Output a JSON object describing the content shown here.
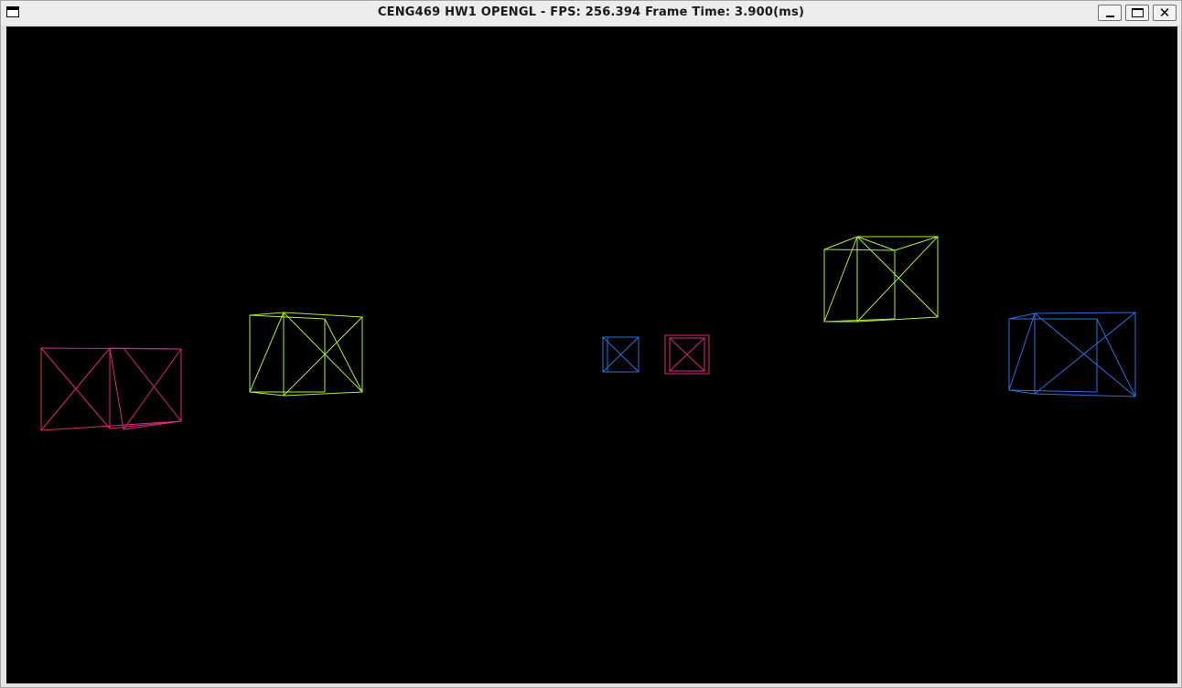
{
  "window": {
    "title": "CENG469 HW1 OPENGL - FPS: 256.394 Frame Time: 3.900(ms)",
    "buttons": {
      "minimize_icon": "minimize-icon",
      "maximize_icon": "maximize-icon",
      "close_icon": "close-icon",
      "close_glyph": "✕"
    }
  },
  "scene": {
    "background": "#000000",
    "colors": {
      "pink": "#e0267a",
      "green": "#a8f03c",
      "blue": "#2f6fe0"
    },
    "objects": [
      {
        "name": "pink-cube-left",
        "color": "pink"
      },
      {
        "name": "green-cube-left",
        "color": "green"
      },
      {
        "name": "blue-cube-center",
        "color": "blue"
      },
      {
        "name": "pink-cube-center",
        "color": "pink"
      },
      {
        "name": "green-cube-right",
        "color": "green"
      },
      {
        "name": "blue-cube-right",
        "color": "blue"
      }
    ]
  }
}
